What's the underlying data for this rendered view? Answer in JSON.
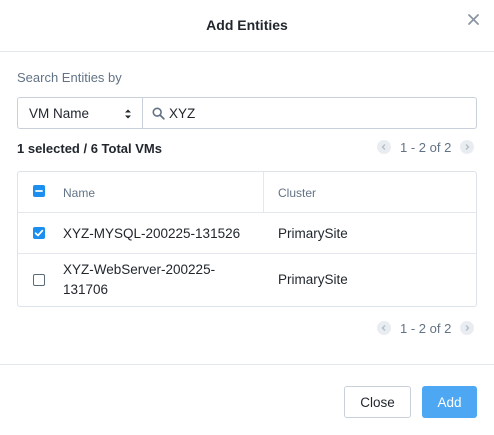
{
  "dialog": {
    "title": "Add Entities"
  },
  "search": {
    "label": "Search Entities by",
    "field_selected": "VM Name",
    "query": "XYZ"
  },
  "summary": "1 selected / 6 Total VMs",
  "pagination": {
    "top_text": "1 - 2 of 2",
    "bottom_text": "1 - 2 of 2"
  },
  "table": {
    "columns": [
      "Name",
      "Cluster"
    ],
    "header_checkbox_state": "indeterminate",
    "rows": [
      {
        "name": "XYZ-MYSQL-200225-131526",
        "cluster": "PrimarySite",
        "selected": true
      },
      {
        "name_line1": "XYZ-WebServer-200225-",
        "name_line2": "131706",
        "cluster": "PrimarySite",
        "selected": false
      }
    ]
  },
  "buttons": {
    "close": "Close",
    "add": "Add"
  },
  "colors": {
    "accent": "#1b8ef0",
    "primary_button": "#4da7f3",
    "muted_text": "#627386",
    "border": "#c8d0da"
  },
  "icons": {
    "close": "close-icon",
    "search": "search-icon",
    "select_arrows": "select-arrows-icon",
    "prev": "chevron-left-icon",
    "next": "chevron-right-icon"
  }
}
